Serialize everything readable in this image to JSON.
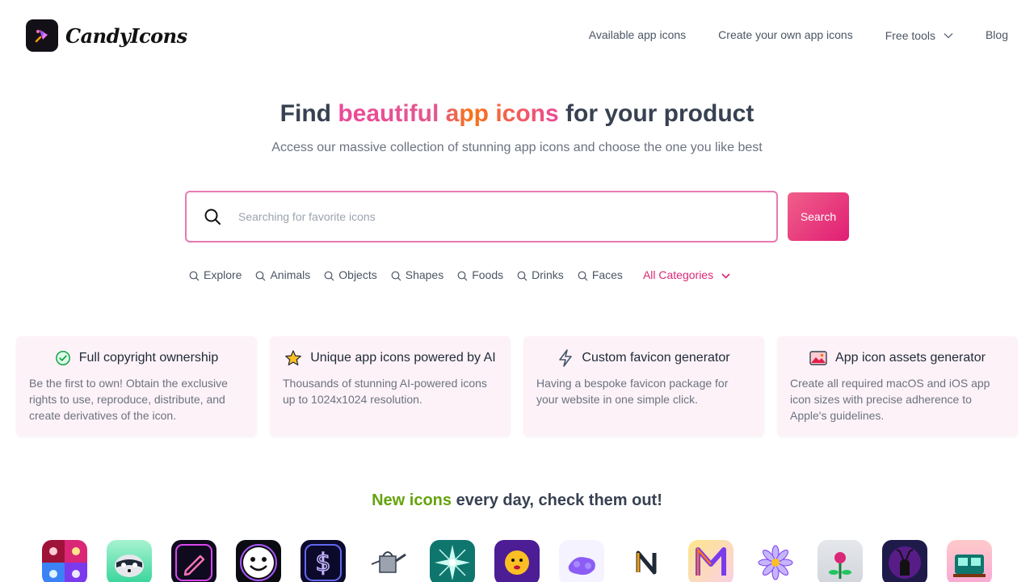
{
  "brand": {
    "name": "CandyIcons"
  },
  "nav": {
    "links": [
      "Available app icons",
      "Create your own app icons"
    ],
    "free_tools": "Free tools",
    "blog": "Blog"
  },
  "hero": {
    "title_pre": "Find ",
    "title_highlight": "beautiful app icons",
    "title_post": " for your product",
    "subtitle": "Access our massive collection of stunning app icons and choose the one you like best"
  },
  "search": {
    "placeholder": "Searching for favorite icons",
    "value": "",
    "button": "Search"
  },
  "categories": {
    "items": [
      "Explore",
      "Animals",
      "Objects",
      "Shapes",
      "Foods",
      "Drinks",
      "Faces"
    ],
    "all": "All Categories"
  },
  "features": [
    {
      "title": "Full copyright ownership",
      "icon": "check-badge-icon",
      "text": "Be the first to own! Obtain the exclusive rights to use, reproduce, distribute, and create derivatives of the icon."
    },
    {
      "title": "Unique app icons powered by AI",
      "icon": "star-icon",
      "text": "Thousands of stunning AI-powered icons up to 1024x1024 resolution."
    },
    {
      "title": "Custom favicon generator",
      "icon": "lightning-icon",
      "text": "Having a bespoke favicon package for your website in one simple click."
    },
    {
      "title": "App icon assets generator",
      "icon": "image-icon",
      "text": "Create all required macOS and iOS app icon sizes with precise adherence to Apple's guidelines."
    }
  ],
  "new_icons": {
    "title_highlight": "New icons",
    "title_rest": " every day, check them out!"
  },
  "colors": {
    "accent": "#ec4899",
    "button": "#e11d74",
    "green": "#65a30d",
    "card_bg": "#fdf2f8"
  }
}
